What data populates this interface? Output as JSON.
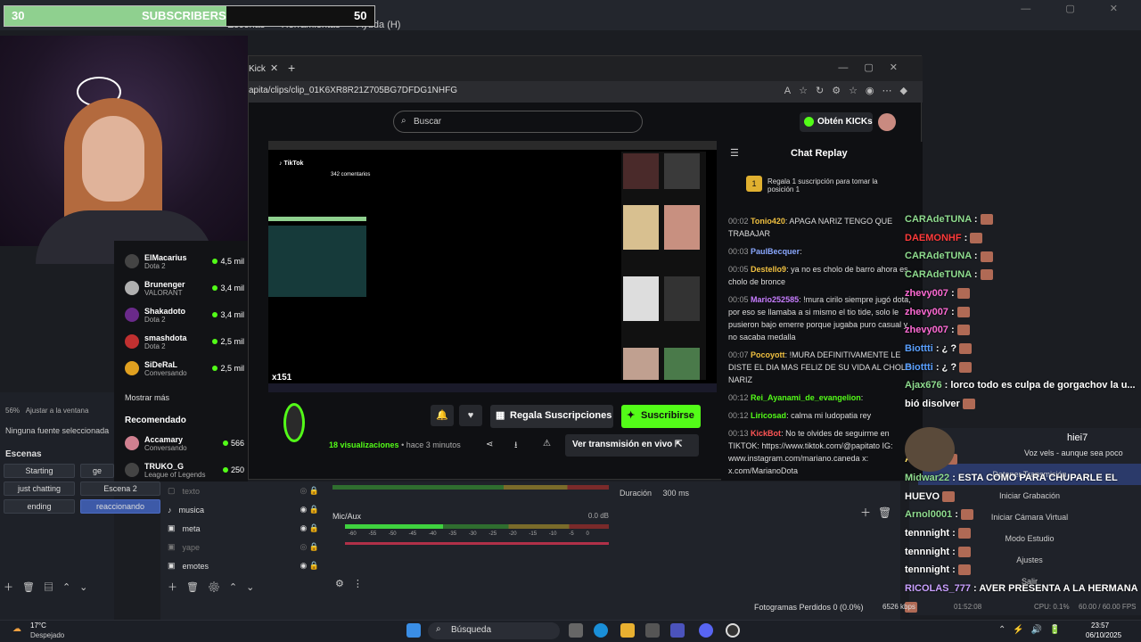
{
  "subscriber_goal": {
    "current": "30",
    "label": "SUBSCRIBERS",
    "target": "50",
    "fill_fraction": 0.6
  },
  "obs": {
    "menu": [
      "Escenas",
      "Herramientas",
      "Ayuda (H)"
    ],
    "audio_label": "Ajustar a la ventana",
    "zoom": "56%",
    "no_source": "Ninguna fuente seleccionada",
    "scenes_title": "Escenas",
    "scenes": [
      {
        "label": "Starting"
      },
      {
        "label": "ge"
      },
      {
        "label": "just chatting"
      },
      {
        "label": "Escena 2"
      },
      {
        "label": "ending"
      },
      {
        "label": "reaccionando"
      }
    ],
    "sources": [
      "texto",
      "musica",
      "meta",
      "yape",
      "emotes"
    ],
    "mixer_label": "Mic/Aux",
    "mixer_db": "0.0 dB",
    "ticks": [
      "-60",
      "-55",
      "-50",
      "-45",
      "-40",
      "-35",
      "-30",
      "-25",
      "-20",
      "-15",
      "-10",
      "-5",
      "0"
    ],
    "duration_label": "Duración",
    "duration_value": "300 ms",
    "controls": [
      "Detener Transmisión",
      "Iniciar Grabación",
      "Iniciar Cámara Virtual",
      "Modo Estudio",
      "Ajustes",
      "Salir"
    ],
    "frames_dropped": "Fotogramas Perdidos 0 (0.0%)",
    "bitrate": "6526 kbps",
    "rec_time": "01:52:08",
    "cpu": "CPU: 0.1%",
    "fps": "60.00 / 60.00 FPS"
  },
  "browser": {
    "tab": "Kick",
    "url": "apita/clips/clip_01K6XR8R21Z705BG7DFDG1NHFG",
    "search_placeholder": "Buscar",
    "kicks_button": "Obtén KICKs",
    "chat_title": "Chat Replay",
    "gift_prompt": "Regala 1 suscripción para tomar la posición 1",
    "messages": [
      {
        "t": "00:02",
        "user": "Tonio420",
        "color": "#f0c040",
        "text": ": APAGA NARIZ TENGO QUE TRABAJAR"
      },
      {
        "t": "00:03",
        "user": "PaulBecquer",
        "color": "#8aa8ff",
        "text": ":"
      },
      {
        "t": "00:05",
        "user": "Destello9",
        "color": "#f0c040",
        "text": ": ya no es cholo de barro ahora es cholo de bronce"
      },
      {
        "t": "00:05",
        "user": "Mario252585",
        "color": "#c77dff",
        "text": ": !mura cirilo siempre jugó dota, por eso se llamaba a si mismo el tio tide, solo le pusieron bajo emerre porque jugaba puro casual y no sacaba medalla"
      },
      {
        "t": "00:07",
        "user": "Pocoyott",
        "color": "#f0c040",
        "text": ": !MURA DEFINITIVAMENTE LE DISTE EL DIA MAS FELIZ DE SU VIDA AL CHOLO NARIZ"
      },
      {
        "t": "00:12",
        "user": "Rei_Ayanami_de_evangelion",
        "color": "#53fc18",
        "text": ":"
      },
      {
        "t": "00:12",
        "user": "Liricosad",
        "color": "#53fc18",
        "text": ": calma mi ludopatia rey"
      },
      {
        "t": "00:13",
        "user": "KickBot",
        "color": "#ff5555",
        "text": ": No te olvides de seguirme en TIKTOK: https://www.tiktok.com/@papitato IG: www.instagram.com/mariano.caneda x: x.com/MarianoDota"
      }
    ],
    "gift_button": "Regala Suscripciones",
    "subscribe_button": "Suscribirse",
    "views_count": "18 visualizaciones",
    "views_age": "• hace 3 minutos",
    "live_button": "Ver transmisión en vivo",
    "video_overlay": "x151"
  },
  "kick_sidebar": {
    "streamers": [
      {
        "name": "ElMacarius",
        "game": "Dota 2",
        "count": "4,5 mil",
        "color": "#444"
      },
      {
        "name": "Brunenger",
        "game": "VALORANT",
        "count": "3,4 mil",
        "color": "#b0b0b0"
      },
      {
        "name": "Shakadoto",
        "game": "Dota 2",
        "count": "3,4 mil",
        "color": "#6a2a8a"
      },
      {
        "name": "smashdota",
        "game": "Dota 2",
        "count": "2,5 mil",
        "color": "#c03030"
      },
      {
        "name": "SiDeRaL",
        "game": "Conversando",
        "count": "2,5 mil",
        "color": "#e0a020"
      }
    ],
    "show_more": "Mostrar más",
    "recommended_title": "Recomendado",
    "recommended": [
      {
        "name": "Accamary",
        "game": "Conversando",
        "count": "566",
        "color": "#d08090"
      },
      {
        "name": "TRUKO_G",
        "game": "League of Legends",
        "count": "250",
        "color": "#444"
      }
    ]
  },
  "overlay_chat": [
    {
      "user": "CARAdeTUNA",
      "color": "#8fdc8f",
      "text": ":"
    },
    {
      "user": "DAEMONHF",
      "color": "#ff3b3b",
      "text": ":"
    },
    {
      "user": "CARAdeTUNA",
      "color": "#8fdc8f",
      "text": ":"
    },
    {
      "user": "CARAdeTUNA",
      "color": "#8fdc8f",
      "text": ":"
    },
    {
      "user": "zhevy007",
      "color": "#ff6bd5",
      "text": ":"
    },
    {
      "user": "zhevy007",
      "color": "#ff6bd5",
      "text": ":"
    },
    {
      "user": "zhevy007",
      "color": "#ff6bd5",
      "text": ":"
    },
    {
      "user": "Biottti",
      "color": "#5aa0ff",
      "text": ": ¿ ?"
    },
    {
      "user": "Biottti",
      "color": "#5aa0ff",
      "text": ": ¿ ?"
    },
    {
      "user": "Ajax676",
      "color": "#8fdc8f",
      "text": ": lorco todo es culpa de gorgachov la u... bió disolver"
    },
    {
      "user": "",
      "color": "#fff",
      "text": ""
    },
    {
      "user": "",
      "color": "#fff",
      "text": ""
    },
    {
      "user": "Ale_41",
      "color": "#ffe066",
      "text": ":"
    },
    {
      "user": "Midwar22",
      "color": "#8fdc8f",
      "text": ": ESTA COMO PARA CHUPARLE EL HUEVO"
    },
    {
      "user": "Arnol0001",
      "color": "#8fdc8f",
      "text": ":"
    },
    {
      "user": "tennnight",
      "color": "#fff",
      "text": ":"
    },
    {
      "user": "tennnight",
      "color": "#fff",
      "text": ":"
    },
    {
      "user": "tennnight",
      "color": "#fff",
      "text": ":"
    },
    {
      "user": "RICOLAS_777",
      "color": "#c9a0ff",
      "text": ": AVER PRESENTA A LA HERMANA"
    }
  ],
  "alert": {
    "name": "hiei7",
    "text": "Voz vels - aunque sea poco"
  },
  "taskbar": {
    "weather_temp": "17°C",
    "weather_desc": "Despejado",
    "search": "Búsqueda",
    "time": "23:57",
    "date": "06/10/2025"
  },
  "colors": {
    "kick_green": "#53fc18",
    "obs_blue": "#3d5aa8"
  }
}
